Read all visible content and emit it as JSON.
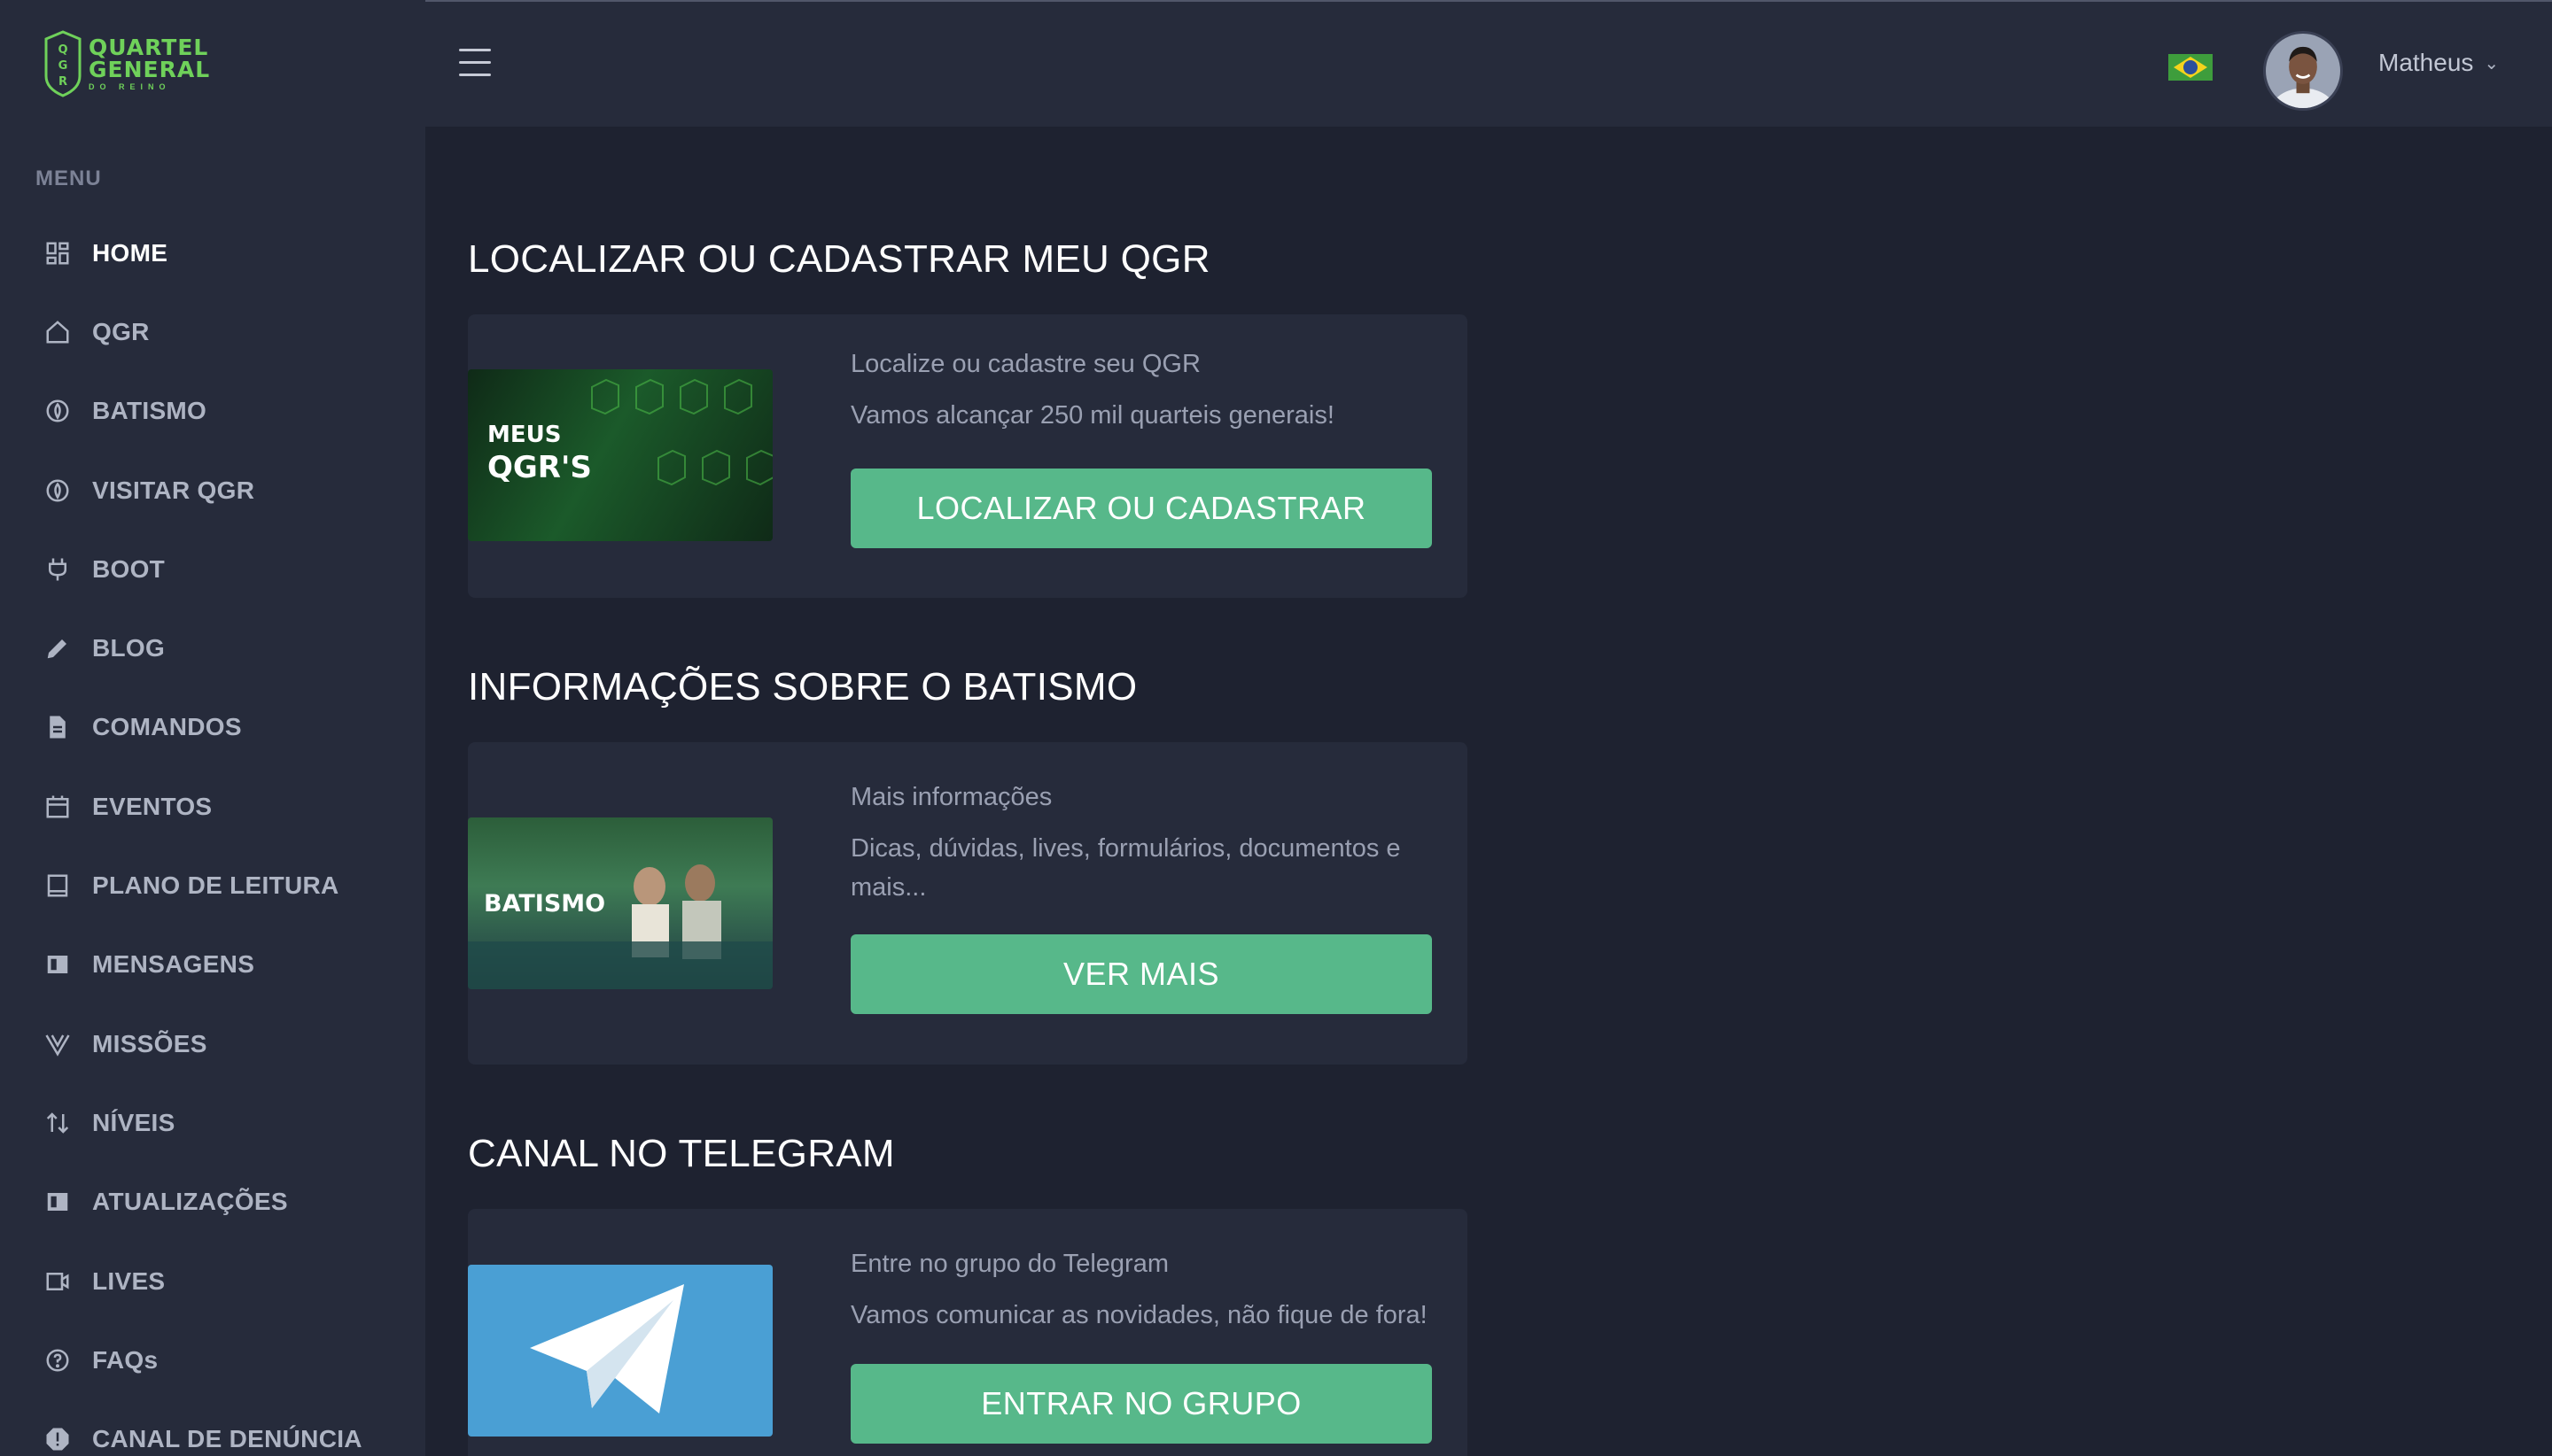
{
  "brand": {
    "shield_text": "QGR",
    "line1": "QUARTEL",
    "line2": "GENERAL",
    "line3": "DO REINO",
    "accent": "#6fd15a"
  },
  "sidebar": {
    "menu_title": "MENU",
    "items": [
      {
        "label": "HOME",
        "icon": "dashboard-grid-icon",
        "active": true
      },
      {
        "label": "QGR",
        "icon": "home-icon"
      },
      {
        "label": "BATISMO",
        "icon": "flame-icon"
      },
      {
        "label": "VISITAR QGR",
        "icon": "flame-icon"
      },
      {
        "label": "BOOT",
        "icon": "plug-icon"
      },
      {
        "label": "BLOG",
        "icon": "pencil-icon"
      },
      {
        "label": "COMANDOS",
        "icon": "document-icon"
      },
      {
        "label": "EVENTOS",
        "icon": "calendar-icon"
      },
      {
        "label": "PLANO DE LEITURA",
        "icon": "book-icon"
      },
      {
        "label": "MENSAGENS",
        "icon": "newspaper-icon"
      },
      {
        "label": "MISSÕES",
        "icon": "vue-icon"
      },
      {
        "label": "NÍVEIS",
        "icon": "sort-arrows-icon"
      },
      {
        "label": "ATUALIZAÇÕES",
        "icon": "newspaper-icon"
      },
      {
        "label": "LIVES",
        "icon": "video-icon"
      },
      {
        "label": "FAQs",
        "icon": "help-circle-icon"
      },
      {
        "label": "CANAL DE DENÚNCIA",
        "icon": "alert-icon"
      }
    ]
  },
  "header": {
    "user_name": "Matheus",
    "language_flag": "brazil-flag-icon"
  },
  "sections": [
    {
      "title": "LOCALIZAR OU CADASTRAR MEU QGR",
      "thumb_text_1": "MEUS",
      "thumb_text_2": "QGR'S",
      "line1": "Localize ou cadastre seu QGR",
      "line2": "Vamos alcançar 250 mil quarteis generais!",
      "button": "LOCALIZAR OU CADASTRAR"
    },
    {
      "title": "INFORMAÇÕES SOBRE O BATISMO",
      "thumb_text_1": "BATISMO",
      "line1": "Mais informações",
      "line2": "Dicas, dúvidas, lives, formulários, documentos e mais...",
      "button": "VER MAIS"
    },
    {
      "title": "CANAL NO TELEGRAM",
      "line1": "Entre no grupo do Telegram",
      "line2": "Vamos comunicar as novidades, não fique de fora!",
      "button": "ENTRAR NO GRUPO"
    }
  ],
  "colors": {
    "background": "#1e2230",
    "panel": "#262b3b",
    "button": "#57b88a",
    "telegram_blue": "#4a9fd4"
  }
}
